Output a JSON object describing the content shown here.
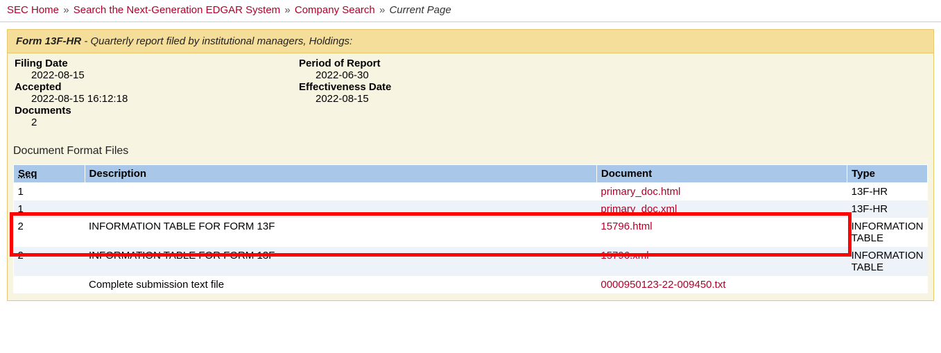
{
  "breadcrumb": {
    "items": [
      {
        "label": "SEC Home"
      },
      {
        "label": "Search the Next-Generation EDGAR System"
      },
      {
        "label": "Company Search"
      }
    ],
    "current": "Current Page",
    "sep": "»"
  },
  "form": {
    "type": "Form 13F-HR",
    "desc": " - Quarterly report filed by institutional managers, Holdings:"
  },
  "meta": {
    "filing_date_label": "Filing Date",
    "filing_date": "2022-08-15",
    "accepted_label": "Accepted",
    "accepted": "2022-08-15 16:12:18",
    "documents_label": "Documents",
    "documents": "2",
    "period_label": "Period of Report",
    "period": "2022-06-30",
    "eff_label": "Effectiveness Date",
    "eff": "2022-08-15"
  },
  "table": {
    "title": "Document Format Files",
    "headers": {
      "seq": "Seq",
      "desc": "Description",
      "doc": "Document",
      "type": "Type"
    },
    "rows": [
      {
        "seq": "1",
        "desc": "",
        "doc": "primary_doc.html",
        "type": "13F-HR"
      },
      {
        "seq": "1",
        "desc": "",
        "doc": "primary_doc.xml",
        "type": "13F-HR"
      },
      {
        "seq": "2",
        "desc": "INFORMATION TABLE FOR FORM 13F",
        "doc": "15796.html",
        "type": "INFORMATION TABLE"
      },
      {
        "seq": "2",
        "desc": "INFORMATION TABLE FOR FORM 13F",
        "doc": "15796.xml",
        "type": "INFORMATION TABLE"
      },
      {
        "seq": "",
        "desc": "Complete submission text file",
        "doc": "0000950123-22-009450.txt",
        "type": ""
      }
    ]
  }
}
